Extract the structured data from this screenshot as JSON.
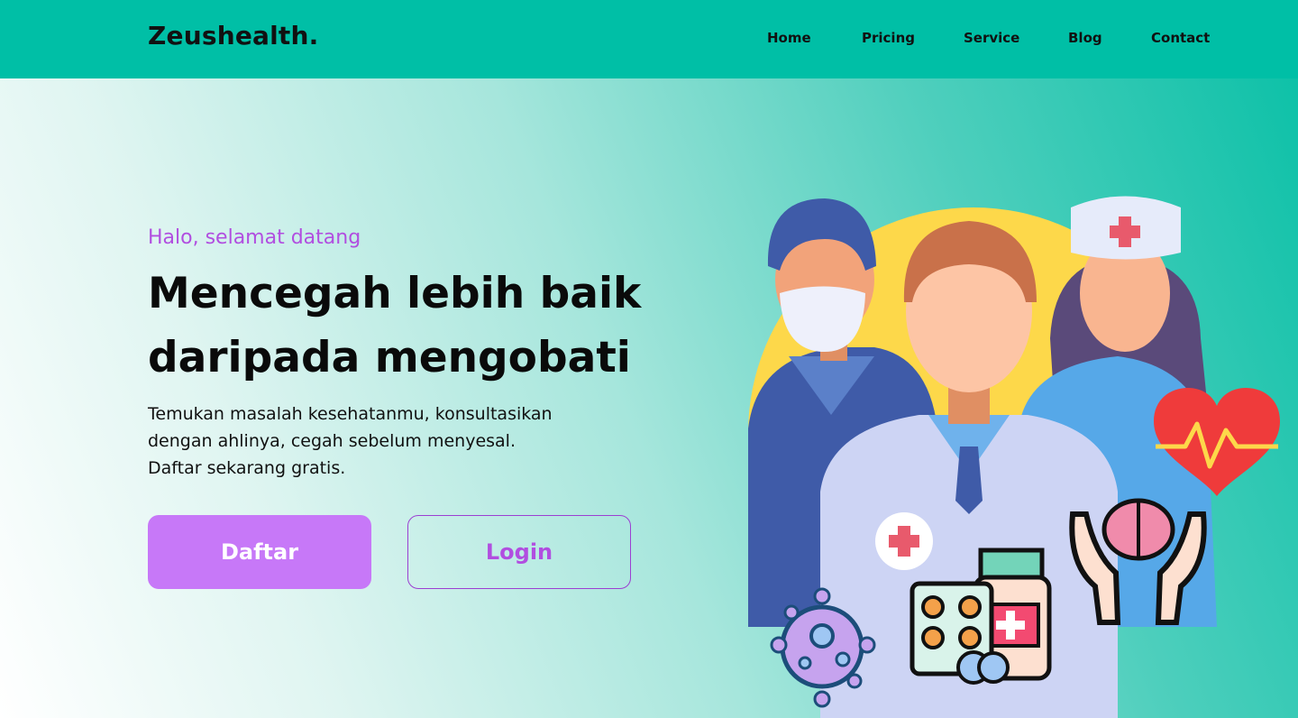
{
  "brand": {
    "name": "Zeushealth."
  },
  "nav": {
    "items": [
      {
        "label": "Home"
      },
      {
        "label": "Pricing"
      },
      {
        "label": "Service"
      },
      {
        "label": "Blog"
      },
      {
        "label": "Contact"
      }
    ]
  },
  "hero": {
    "greeting": "Halo, selamat datang",
    "headline_lines": [
      "Mencegah lebih baik",
      "daripada mengobati"
    ],
    "description_lines": [
      "Temukan masalah kesehatanmu, konsultasikan",
      "dengan ahlinya, cegah sebelum menyesal.",
      "Daftar sekarang gratis."
    ],
    "primary_button": "Daftar",
    "secondary_button": "Login"
  },
  "colors": {
    "navbar": "#00bfa6",
    "accent_purple": "#b14ee0",
    "button_fill": "#c778f8"
  },
  "illustration": {
    "icons": [
      "surgeon",
      "doctor",
      "nurse",
      "heart-pulse-icon",
      "brain-hands-icon",
      "virus-icon",
      "medicine-icon"
    ]
  }
}
